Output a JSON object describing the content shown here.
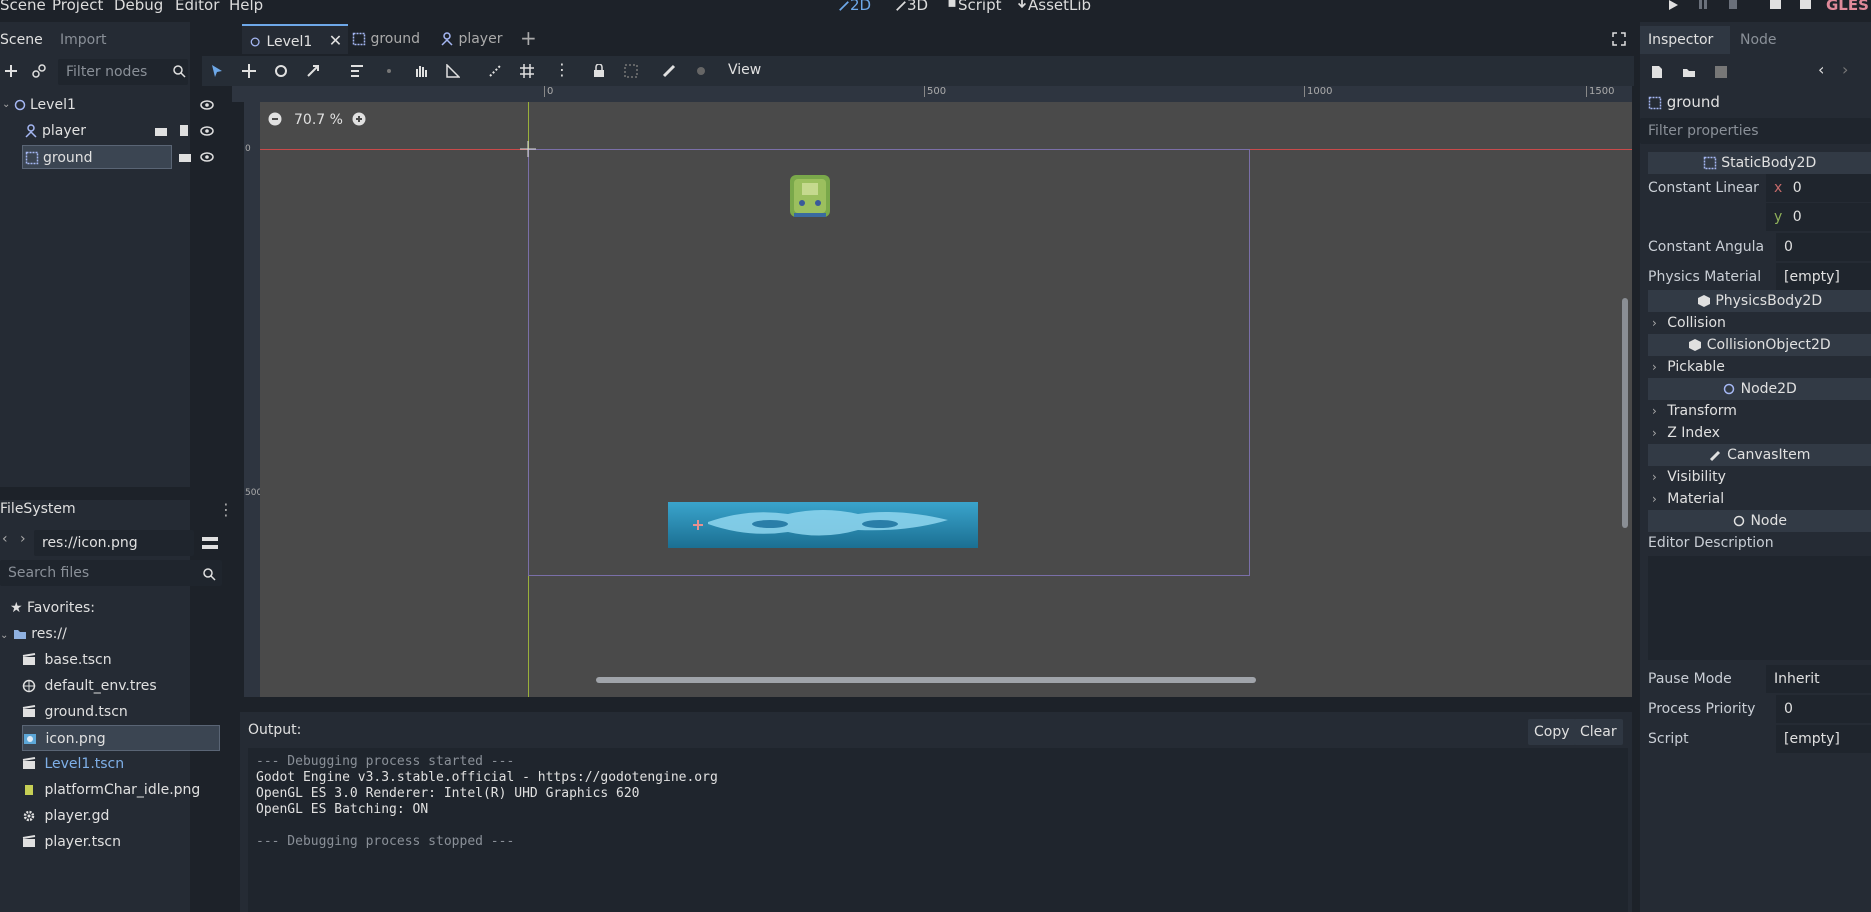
{
  "menu": [
    "Scene",
    "Project",
    "Debug",
    "Editor",
    "Help"
  ],
  "modes": [
    {
      "label": "2D",
      "active": true
    },
    {
      "label": "3D",
      "active": false
    },
    {
      "label": "Script",
      "active": false
    },
    {
      "label": "AssetLib",
      "active": false
    }
  ],
  "renderer": "GLES",
  "scene_dock": {
    "tabs": [
      "Scene",
      "Import"
    ],
    "filter_placeholder": "Filter nodes",
    "nodes": [
      {
        "name": "Level1"
      },
      {
        "name": "player"
      },
      {
        "name": "ground"
      }
    ]
  },
  "filesystem": {
    "title": "FileSystem",
    "path": "res://icon.png",
    "search_placeholder": "Search files",
    "favorites": "Favorites:",
    "root": "res://",
    "files": [
      {
        "name": "base.tscn"
      },
      {
        "name": "default_env.tres"
      },
      {
        "name": "ground.tscn"
      },
      {
        "name": "icon.png"
      },
      {
        "name": "Level1.tscn"
      },
      {
        "name": "platformChar_idle.png"
      },
      {
        "name": "player.gd"
      },
      {
        "name": "player.tscn"
      }
    ]
  },
  "editor_tabs": [
    {
      "label": "Level1"
    },
    {
      "label": "ground"
    },
    {
      "label": "player"
    }
  ],
  "toolbar": {
    "view_label": "View"
  },
  "zoom_label": "70.7 %",
  "ruler": {
    "top": [
      "0",
      "500",
      "1000",
      "1500"
    ],
    "left": [
      "0",
      "500"
    ]
  },
  "output": {
    "title": "Output:",
    "copy": "Copy",
    "clear": "Clear",
    "lines": [
      "--- Debugging process started ---",
      "Godot Engine v3.3.stable.official - https://godotengine.org",
      "OpenGL ES 3.0 Renderer: Intel(R) UHD Graphics 620",
      "OpenGL ES Batching: ON",
      "",
      "--- Debugging process stopped ---"
    ]
  },
  "inspector": {
    "tabs": [
      "Inspector",
      "Node"
    ],
    "node_name": "ground",
    "filter_placeholder": "Filter properties",
    "sections": {
      "static_body": "StaticBody2D",
      "physics_body": "PhysicsBody2D",
      "collision_object": "CollisionObject2D",
      "node2d": "Node2D",
      "canvas_item": "CanvasItem",
      "node": "Node"
    },
    "constant_linear": {
      "label": "Constant Linear",
      "x_label": "x",
      "x": "0",
      "y_label": "y",
      "y": "0"
    },
    "constant_angular": {
      "label": "Constant Angula",
      "value": "0"
    },
    "physics_material": {
      "label": "Physics Material",
      "value": "[empty]"
    },
    "groups": {
      "collision": "Collision",
      "pickable": "Pickable",
      "transform": "Transform",
      "z_index": "Z Index",
      "visibility": "Visibility",
      "material": "Material"
    },
    "editor_description": "Editor Description",
    "pause_mode": {
      "label": "Pause Mode",
      "value": "Inherit"
    },
    "process_priority": {
      "label": "Process Priority",
      "value": "0"
    },
    "script": {
      "label": "Script",
      "value": "[empty]"
    }
  }
}
